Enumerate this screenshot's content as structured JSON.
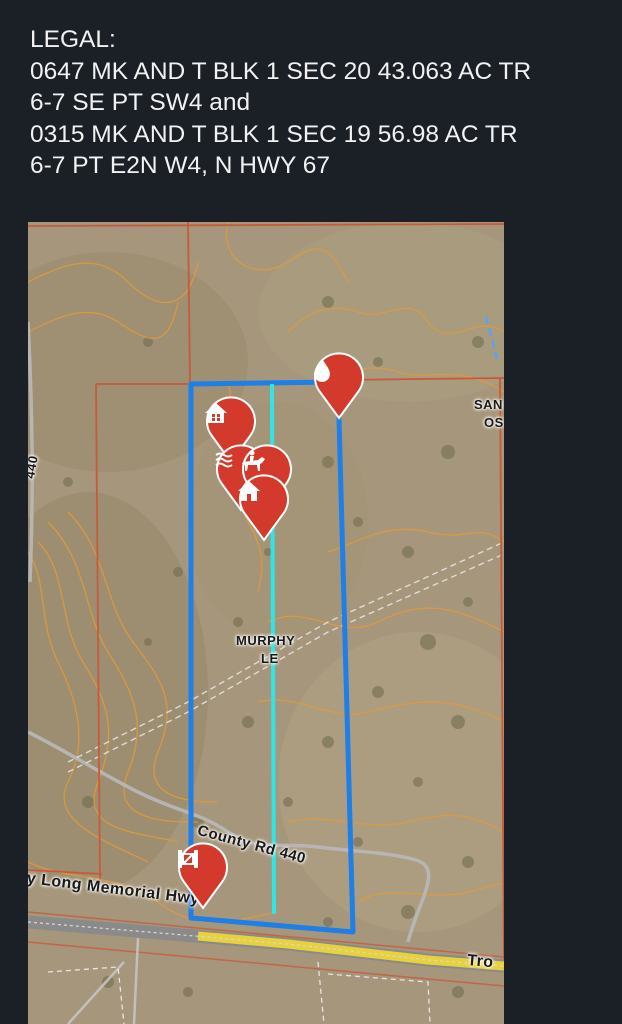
{
  "legal": {
    "lines": [
      "LEGAL:",
      "0647 MK AND T BLK 1 SEC 20 43.063 AC TR",
      "6-7 SE PT SW4 and",
      "0315 MK AND T BLK 1 SEC 19 56.98 AC TR",
      "6-7 PT E2N W4, N HWY 67"
    ]
  },
  "map": {
    "labels": {
      "county_rd": "County Rd 440",
      "highway": "y Long Memorial Hwy",
      "edge_right_bottom": "Tro",
      "edge_left": "440",
      "murphy_line1": "MURPHY",
      "murphy_line2": "LE",
      "san_line1": "SAN",
      "san_line2": "OS"
    },
    "markers": [
      {
        "icon": "water-drop-icon"
      },
      {
        "icon": "house-icon"
      },
      {
        "icon": "stream-icon"
      },
      {
        "icon": "horse-rider-icon"
      },
      {
        "icon": "home-icon"
      },
      {
        "icon": "entrance-gate-icon"
      }
    ],
    "colors": {
      "boundary": "#1e7fe8",
      "divider": "#2ee6e6",
      "marker": "#d43a2c",
      "parcel_lines": "#c85a3c",
      "contours": "#e39a3a",
      "highway_fill": "#e8d23c"
    }
  }
}
